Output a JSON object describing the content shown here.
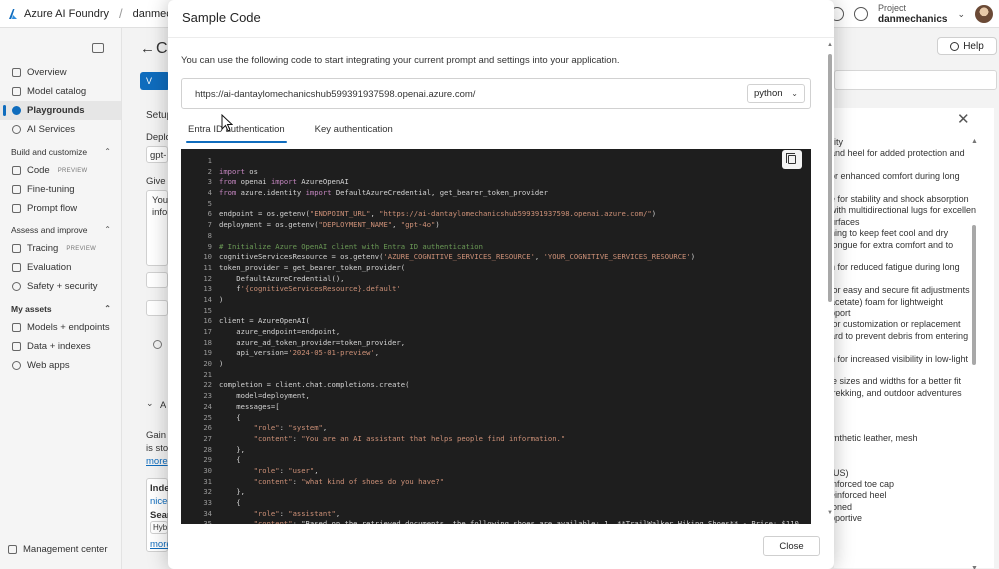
{
  "topbar": {
    "brand": "Azure AI Foundry",
    "breadcrumb_project": "danmechanics",
    "project_label": "Project",
    "project_name": "danmechanics"
  },
  "sidebar": {
    "items_top": [
      {
        "label": "Overview",
        "icon": "overview-icon"
      },
      {
        "label": "Model catalog",
        "icon": "catalog-icon"
      },
      {
        "label": "Playgrounds",
        "icon": "playground-icon",
        "active": true
      },
      {
        "label": "AI Services",
        "icon": "services-icon"
      }
    ],
    "section_build": "Build and customize",
    "items_build": [
      {
        "label": "Code",
        "badge": "PREVIEW"
      },
      {
        "label": "Fine-tuning"
      },
      {
        "label": "Prompt flow"
      }
    ],
    "section_assess": "Assess and improve",
    "items_assess": [
      {
        "label": "Tracing",
        "badge": "PREVIEW"
      },
      {
        "label": "Evaluation"
      },
      {
        "label": "Safety + security"
      }
    ],
    "section_assets": "My assets",
    "items_assets": [
      {
        "label": "Models + endpoints"
      },
      {
        "label": "Data + indexes"
      },
      {
        "label": "Web apps"
      }
    ],
    "management": "Management center"
  },
  "background": {
    "title": "Cl",
    "help": "Help",
    "view_btn": "V",
    "setup": "Setup",
    "deploy": "Deplo",
    "gpt": "gpt-",
    "give": "Give t",
    "you": "You",
    "info": "infor",
    "a_section": "A",
    "gain": "Gain i",
    "is_stor": "is stor",
    "more1": "more",
    "index": "Index",
    "nice": "nice-",
    "search": "Searc",
    "hyb": "Hyb",
    "more2": "more",
    "right_lines": [
      "ility",
      "and heel for added protection and",
      "",
      "or enhanced comfort during long",
      "",
      "e for stability and shock absorption",
      "with multidirectional lugs for excellent",
      "urfaces",
      "ning to keep feet cool and dry",
      "tongue for extra comfort and to",
      "",
      "n for reduced fatigue during long",
      "",
      "for easy and secure fit adjustments",
      "acetate) foam for lightweight",
      "pport",
      "for customization or replacement",
      "ard to prevent debris from entering",
      "",
      "n for increased visibility in low-light",
      "",
      "le sizes and widths for a better fit",
      " trekking, and outdoor adventures",
      "",
      "",
      "",
      "ynthetic leather, mesh",
      "",
      "",
      "(US)",
      "inforced toe cap",
      "einforced heel",
      "ioned",
      "pportive"
    ]
  },
  "modal": {
    "title": "Sample Code",
    "description": "You can use the following code to start integrating your current prompt and settings into your application.",
    "endpoint_url": "https://ai-dantaylomechanicshub599391937598.openai.azure.com/",
    "language": "python",
    "tabs": [
      "Entra ID authentication",
      "Key authentication"
    ],
    "active_tab": 0,
    "close_label": "Close",
    "code_lines": [
      "",
      "import os",
      "from openai import AzureOpenAI",
      "from azure.identity import DefaultAzureCredential, get_bearer_token_provider",
      "",
      "endpoint = os.getenv(\"ENDPOINT_URL\", \"https://ai-dantaylomechanicshub599391937598.openai.azure.com/\")",
      "deployment = os.getenv(\"DEPLOYMENT_NAME\", \"gpt-4o\")",
      "",
      "# Initialize Azure OpenAI client with Entra ID authentication",
      "cognitiveServicesResource = os.getenv('AZURE_COGNITIVE_SERVICES_RESOURCE', 'YOUR_COGNITIVE_SERVICES_RESOURCE')",
      "token_provider = get_bearer_token_provider(",
      "    DefaultAzureCredential(),",
      "    f'{cognitiveServicesResource}.default'",
      ")",
      "",
      "client = AzureOpenAI(",
      "    azure_endpoint=endpoint,",
      "    azure_ad_token_provider=token_provider,",
      "    api_version='2024-05-01-preview',",
      ")",
      "",
      "completion = client.chat.completions.create(",
      "    model=deployment,",
      "    messages=[",
      "    {",
      "        \"role\": \"system\",",
      "        \"content\": \"You are an AI assistant that helps people find information.\"",
      "    },",
      "    {",
      "        \"role\": \"user\",",
      "        \"content\": \"what kind of shoes do you have?\"",
      "    },",
      "    {",
      "        \"role\": \"assistant\",",
      "        \"content\": \"Based on the retrieved documents, the following shoes are available: 1. **TrailWalker Hiking Shoes** - Price: $110 ..."
    ]
  },
  "colors": {
    "accent": "#0f6cbd",
    "code_bg": "#1e1e1e",
    "keyword": "#c586c0",
    "string": "#ce9178",
    "comment": "#6a9955"
  }
}
